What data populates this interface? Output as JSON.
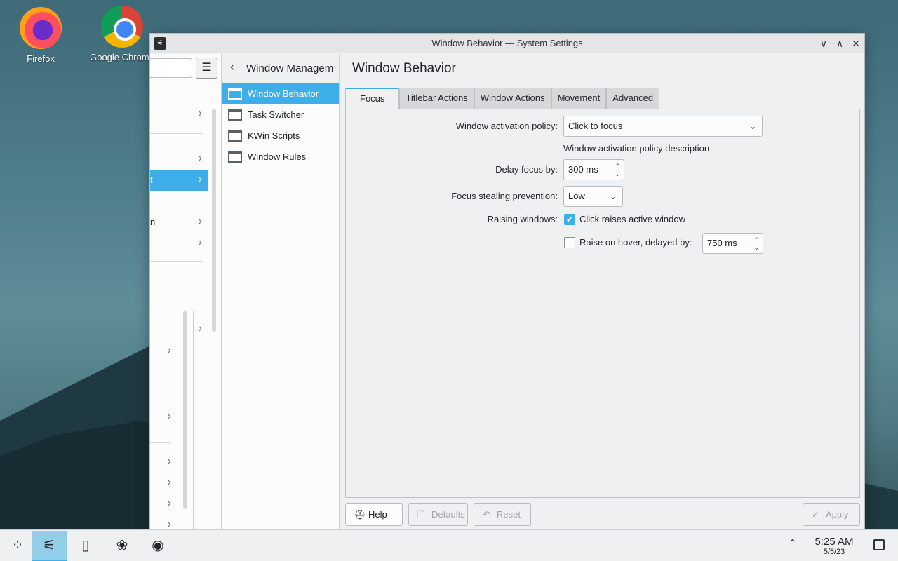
{
  "desktop": {
    "icons": [
      {
        "label": "Firefox",
        "icon": "firefox-icon"
      },
      {
        "label": "Google Chrome",
        "icon": "chrome-icon"
      }
    ]
  },
  "window": {
    "title": "Window Behavior — System Settings",
    "controls": {
      "minimize": "∨",
      "maximize": "∧",
      "close": "✕"
    }
  },
  "sidebar": {
    "search_value": "",
    "menu_icon": "hamburger-icon"
  },
  "subnav": {
    "title": "Window Managem",
    "items": [
      {
        "label": "Window Behavior",
        "active": true
      },
      {
        "label": "Task Switcher",
        "active": false
      },
      {
        "label": "KWin Scripts",
        "active": false
      },
      {
        "label": "Window Rules",
        "active": false
      }
    ]
  },
  "categories": {
    "active_row_label": "t",
    "partial_label": "n"
  },
  "page": {
    "title": "Window Behavior",
    "tabs": [
      "Focus",
      "Titlebar Actions",
      "Window Actions",
      "Movement",
      "Advanced"
    ],
    "active_tab": "Focus"
  },
  "focus": {
    "activation_policy_label": "Window activation policy:",
    "activation_policy_value": "Click to focus",
    "activation_policy_description": "Window activation policy description",
    "delay_focus_label": "Delay focus by:",
    "delay_focus_value": "300 ms",
    "focus_stealing_label": "Focus stealing prevention:",
    "focus_stealing_value": "Low",
    "raising_windows_label": "Raising windows:",
    "click_raises_label": "Click raises active window",
    "click_raises_checked": true,
    "raise_on_hover_label": "Raise on hover, delayed by:",
    "raise_on_hover_checked": false,
    "raise_on_hover_value": "750 ms"
  },
  "footer": {
    "help": "Help",
    "defaults": "Defaults",
    "reset": "Reset",
    "apply": "Apply"
  },
  "taskbar": {
    "time": "5:25 AM",
    "date": "5/5/23"
  },
  "colors": {
    "accent": "#3daee9",
    "window_bg": "#eff0f1"
  }
}
